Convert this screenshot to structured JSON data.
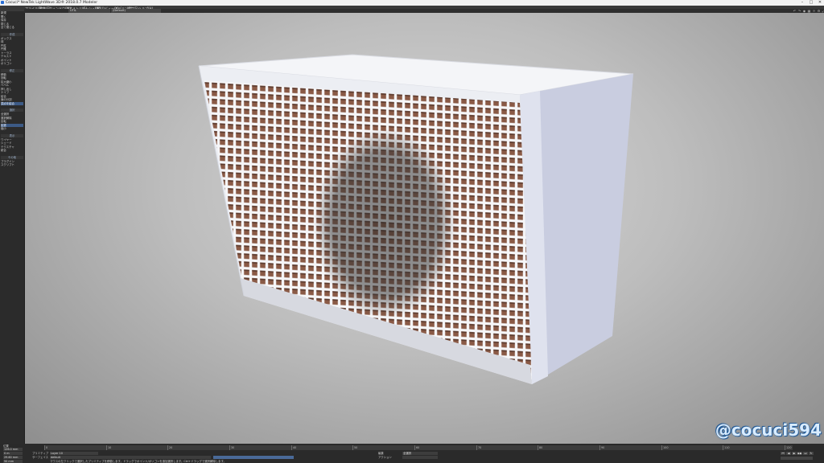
{
  "window": {
    "title": "Cocuci* NewTek LightWave 3D® 2018.0.7 Modeler",
    "controls": [
      "–",
      "□",
      "✕"
    ]
  },
  "menubar": {
    "items": [
      "ファイル(F)",
      "編集(E)",
      "ウィンドウ(W)",
      "ジオメトリ(G)",
      "メッシュ(M)",
      "UV(U)",
      "ビュー(V)",
      "モデリング",
      "設定(S)",
      "ヘルプ(H)"
    ]
  },
  "toolbar": {
    "layer_select": "UTIL",
    "surface_select": "(Default)",
    "icons": [
      "undo-icon",
      "redo-icon",
      "camera-icon",
      "grid-icon",
      "light-icon",
      "settings-icon",
      "expand-icon"
    ]
  },
  "sidebar": {
    "sections": [
      {
        "head": "",
        "items": [
          "新規",
          "開く",
          "保存",
          "閉じる",
          "全て閉じる"
        ]
      },
      {
        "head": "作成",
        "items": [
          "ボックス",
          "球",
          "円柱",
          "円錐",
          "トーラス",
          "テキスト",
          "ポイント",
          "ポリゴン"
        ]
      },
      {
        "head": "修正",
        "items": [
          "移動",
          "回転",
          "拡大縮小",
          "ベベル",
          "押し出し",
          "ナイフ",
          "結合",
          "面の分割",
          "頂点を結合"
        ]
      },
      {
        "head": "選択",
        "items": [
          "全選択",
          "選択解除",
          "反転",
          "拡張",
          "縮小"
        ]
      },
      {
        "head": "表示",
        "items": [
          "ワイヤー",
          "シェード",
          "テクスチャ",
          "統合"
        ]
      },
      {
        "head": "その他",
        "items": [
          "プラグイン",
          "スクリプト"
        ]
      }
    ],
    "highlighted": [
      "頂点を結合",
      "拡張"
    ]
  },
  "viewport": {
    "watermark": "@cocuci594"
  },
  "timeline": {
    "ruler_labels": [
      "0",
      "10",
      "20",
      "30",
      "40",
      "50",
      "60",
      "70",
      "80",
      "90",
      "100",
      "110",
      "120"
    ],
    "position_label": "位置",
    "x_value": "126.0 mm",
    "y_value": "0 m",
    "z_value": "29.60 mm",
    "grid_value": "50 mm",
    "primitive_label": "プリミティブ",
    "primitive_value": "Layer 10",
    "surface_label": "サーフェイス",
    "surface_value": "default",
    "edit_label": "編集",
    "mode_value": "全選択",
    "action_label": "アクション",
    "status_text": "マウスの左クリックで選択したプリミティブを移動します。ドラッグでポイント/ポリゴンを追加選択します。Ctrl+ドラッグで選択解除します。"
  },
  "colors": {
    "accent": "#2a7be0",
    "highlight": "#3c5a86",
    "watermark": "#d9ecff"
  }
}
